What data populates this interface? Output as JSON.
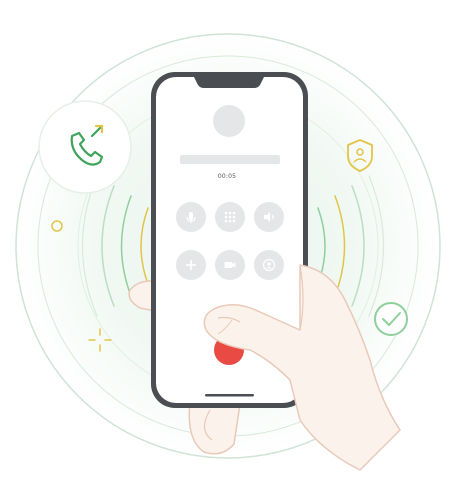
{
  "screen": {
    "call_timer": "00:05"
  },
  "icons": {
    "badge_icon": "phone-transfer-icon",
    "shield_icon": "shield-user-icon",
    "check_icon": "check-circle-icon",
    "buttons": [
      "microphone-icon",
      "keypad-icon",
      "speaker-icon",
      "add-call-icon",
      "video-icon",
      "contacts-icon"
    ],
    "end_call": "end-call-icon"
  },
  "colors": {
    "accent_green": "#3fa35a",
    "accent_yellow": "#e2c44a",
    "end_call_red": "#e94a43",
    "phone_frame": "#4a4d52"
  }
}
